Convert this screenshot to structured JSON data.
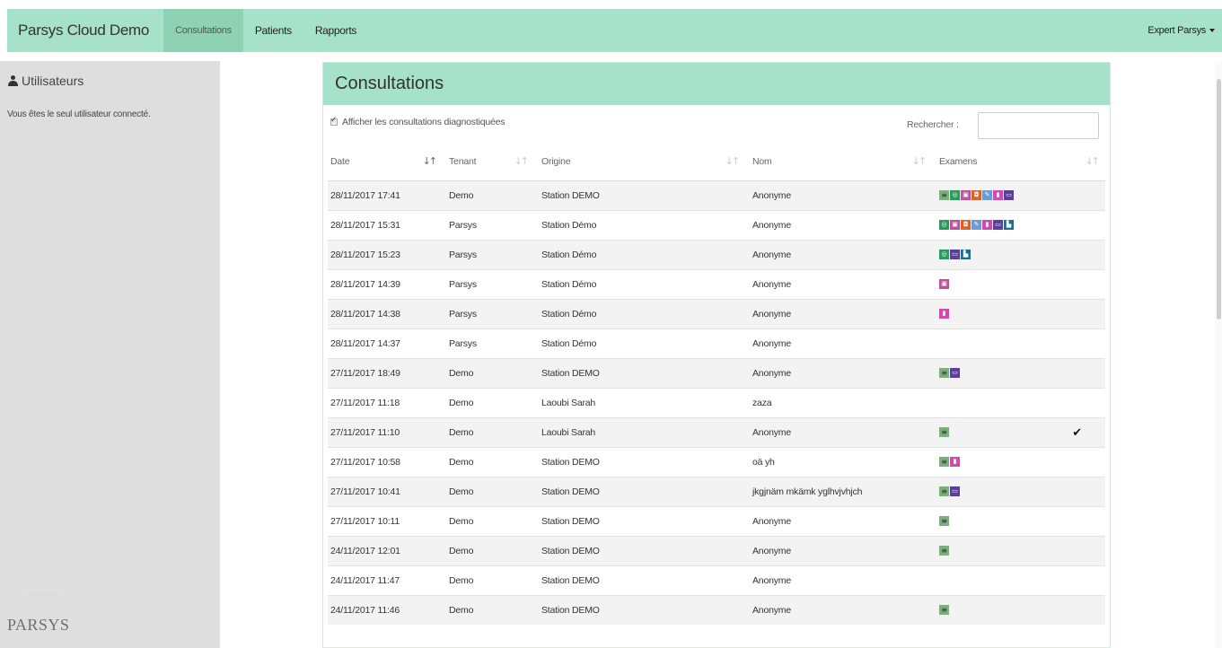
{
  "navbar": {
    "brand": "Parsys Cloud Demo",
    "links": [
      "Consultations",
      "Patients",
      "Rapports"
    ],
    "active": "Consultations",
    "user": "Expert Parsys"
  },
  "sidebar": {
    "title": "Utilisateurs",
    "message": "Vous êtes le seul utilisateur connecté.",
    "logo": "PARSYS"
  },
  "panel": {
    "title": "Consultations",
    "checkbox_label": "Afficher les consultations diagnostiquées",
    "checkbox_checked": true,
    "search_label": "Rechercher :",
    "search_value": "",
    "columns": [
      "Date",
      "Tenant",
      "Origine",
      "Nom",
      "Examens"
    ]
  },
  "rows": [
    {
      "date": "28/11/2017 17:41",
      "tenant": "Demo",
      "origin": "Station DEMO",
      "name": "Anonyme",
      "exams": [
        "ecg",
        "steth",
        "photo",
        "derm",
        "xray",
        "thermo",
        "glucose"
      ],
      "diagnosed": false
    },
    {
      "date": "28/11/2017 15:31",
      "tenant": "Parsys",
      "origin": "Station Démo",
      "name": "Anonyme",
      "exams": [
        "steth",
        "photo",
        "derm",
        "xray",
        "thermo",
        "glucose",
        "tension"
      ],
      "diagnosed": false
    },
    {
      "date": "28/11/2017 15:23",
      "tenant": "Parsys",
      "origin": "Station Démo",
      "name": "Anonyme",
      "exams": [
        "steth",
        "glucose",
        "tension"
      ],
      "diagnosed": false
    },
    {
      "date": "28/11/2017 14:39",
      "tenant": "Parsys",
      "origin": "Station Démo",
      "name": "Anonyme",
      "exams": [
        "photo"
      ],
      "diagnosed": false
    },
    {
      "date": "28/11/2017 14:38",
      "tenant": "Parsys",
      "origin": "Station Démo",
      "name": "Anonyme",
      "exams": [
        "thermo"
      ],
      "diagnosed": false
    },
    {
      "date": "28/11/2017 14:37",
      "tenant": "Parsys",
      "origin": "Station Démo",
      "name": "Anonyme",
      "exams": [],
      "diagnosed": false
    },
    {
      "date": "27/11/2017 18:49",
      "tenant": "Demo",
      "origin": "Station DEMO",
      "name": "Anonyme",
      "exams": [
        "ecg",
        "glucose"
      ],
      "diagnosed": false
    },
    {
      "date": "27/11/2017 11:18",
      "tenant": "Demo",
      "origin": "Laoubi Sarah",
      "name": "zaza",
      "exams": [],
      "diagnosed": false
    },
    {
      "date": "27/11/2017 11:10",
      "tenant": "Demo",
      "origin": "Laoubi Sarah",
      "name": "Anonyme",
      "exams": [
        "ecg"
      ],
      "diagnosed": true
    },
    {
      "date": "27/11/2017 10:58",
      "tenant": "Demo",
      "origin": "Station DEMO",
      "name": "oä yh",
      "exams": [
        "ecg",
        "thermo"
      ],
      "diagnosed": false
    },
    {
      "date": "27/11/2017 10:41",
      "tenant": "Demo",
      "origin": "Station DEMO",
      "name": "jkgjnäm mkämk yglhvjvhjch",
      "exams": [
        "ecg",
        "glucose"
      ],
      "diagnosed": false
    },
    {
      "date": "27/11/2017 10:11",
      "tenant": "Demo",
      "origin": "Station DEMO",
      "name": "Anonyme",
      "exams": [
        "ecg"
      ],
      "diagnosed": false
    },
    {
      "date": "24/11/2017 12:01",
      "tenant": "Demo",
      "origin": "Station DEMO",
      "name": "Anonyme",
      "exams": [
        "ecg"
      ],
      "diagnosed": false
    },
    {
      "date": "24/11/2017 11:47",
      "tenant": "Demo",
      "origin": "Station DEMO",
      "name": "Anonyme",
      "exams": [],
      "diagnosed": false
    },
    {
      "date": "24/11/2017 11:46",
      "tenant": "Demo",
      "origin": "Station DEMO",
      "name": "Anonyme",
      "exams": [
        "ecg"
      ],
      "diagnosed": false
    }
  ],
  "colors": {
    "navbar": "#a6e1c9",
    "active_tab": "#8fd1b5",
    "sidebar": "#dedede"
  }
}
